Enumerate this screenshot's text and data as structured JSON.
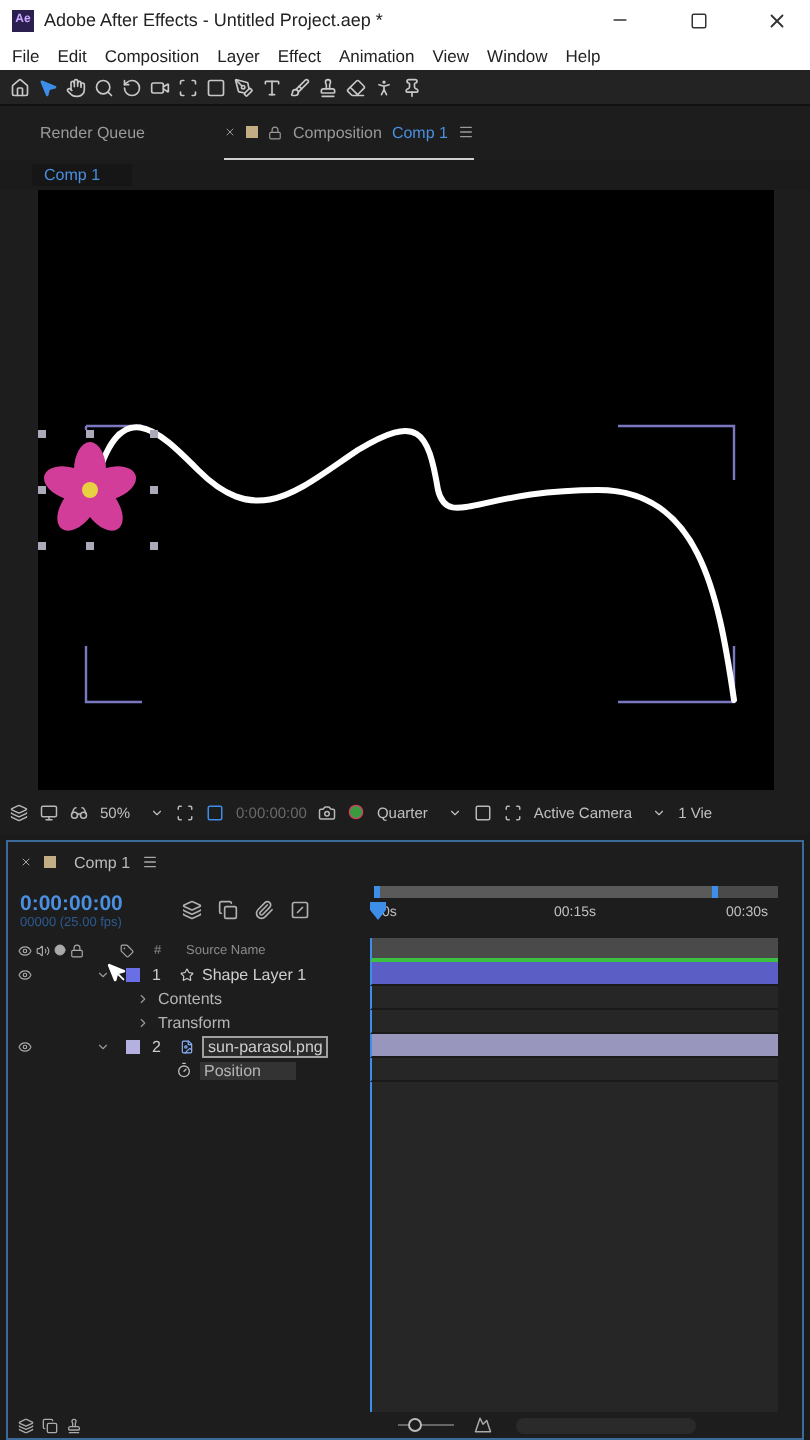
{
  "window": {
    "app_icon": "Ae",
    "title": "Adobe After Effects - Untitled Project.aep *"
  },
  "menu": [
    "File",
    "Edit",
    "Composition",
    "Layer",
    "Effect",
    "Animation",
    "View",
    "Window",
    "Help"
  ],
  "tools": [
    {
      "kind": "home",
      "selected": false
    },
    {
      "kind": "select",
      "selected": true
    },
    {
      "kind": "hand",
      "selected": false
    },
    {
      "kind": "zoom",
      "selected": false
    },
    {
      "kind": "rotate",
      "selected": false
    },
    {
      "kind": "camera",
      "selected": false
    },
    {
      "kind": "anchor",
      "selected": false
    },
    {
      "kind": "rect",
      "selected": false
    },
    {
      "kind": "pen",
      "selected": false
    },
    {
      "kind": "type",
      "selected": false
    },
    {
      "kind": "brush",
      "selected": false
    },
    {
      "kind": "stamp",
      "selected": false
    },
    {
      "kind": "eraser",
      "selected": false
    },
    {
      "kind": "roto",
      "selected": false
    },
    {
      "kind": "pin",
      "selected": false
    }
  ],
  "panel_tabs": [
    {
      "label": "Render Queue",
      "selected": false
    },
    {
      "label": "Composition",
      "comp": "Comp 1",
      "selected": true
    }
  ],
  "breadcrumb": "Comp 1",
  "viewer_bar": {
    "zoom": "50%",
    "timecode": "0:00:00:00",
    "resolution": "Quarter",
    "camera": "Active Camera",
    "views": "1 Vie"
  },
  "timeline": {
    "tab": "Comp 1",
    "timecode": "0:00:00:00",
    "frames": "00000 (25.00 fps)",
    "columns": [
      "#",
      "Source Name"
    ],
    "ruler": [
      "0s",
      "00:15s",
      "00:30s"
    ],
    "work_area": {
      "level": 0.85
    },
    "layers": [
      {
        "number": "1",
        "name": "Shape Layer 1",
        "kind": "shape",
        "color": "#6b6fe6",
        "visible": true,
        "expanded": true,
        "editing": false,
        "properties": [
          {
            "kind": "group",
            "name": "Contents"
          },
          {
            "kind": "group",
            "name": "Transform"
          }
        ]
      },
      {
        "number": "2",
        "name": "sun-parasol.png",
        "kind": "footage",
        "color": "#b4b0e0",
        "visible": true,
        "expanded": true,
        "editing": true,
        "properties": [
          {
            "kind": "stopwatch",
            "name": "Position"
          }
        ]
      }
    ],
    "zoom_slider": {
      "level": 0.3
    }
  }
}
